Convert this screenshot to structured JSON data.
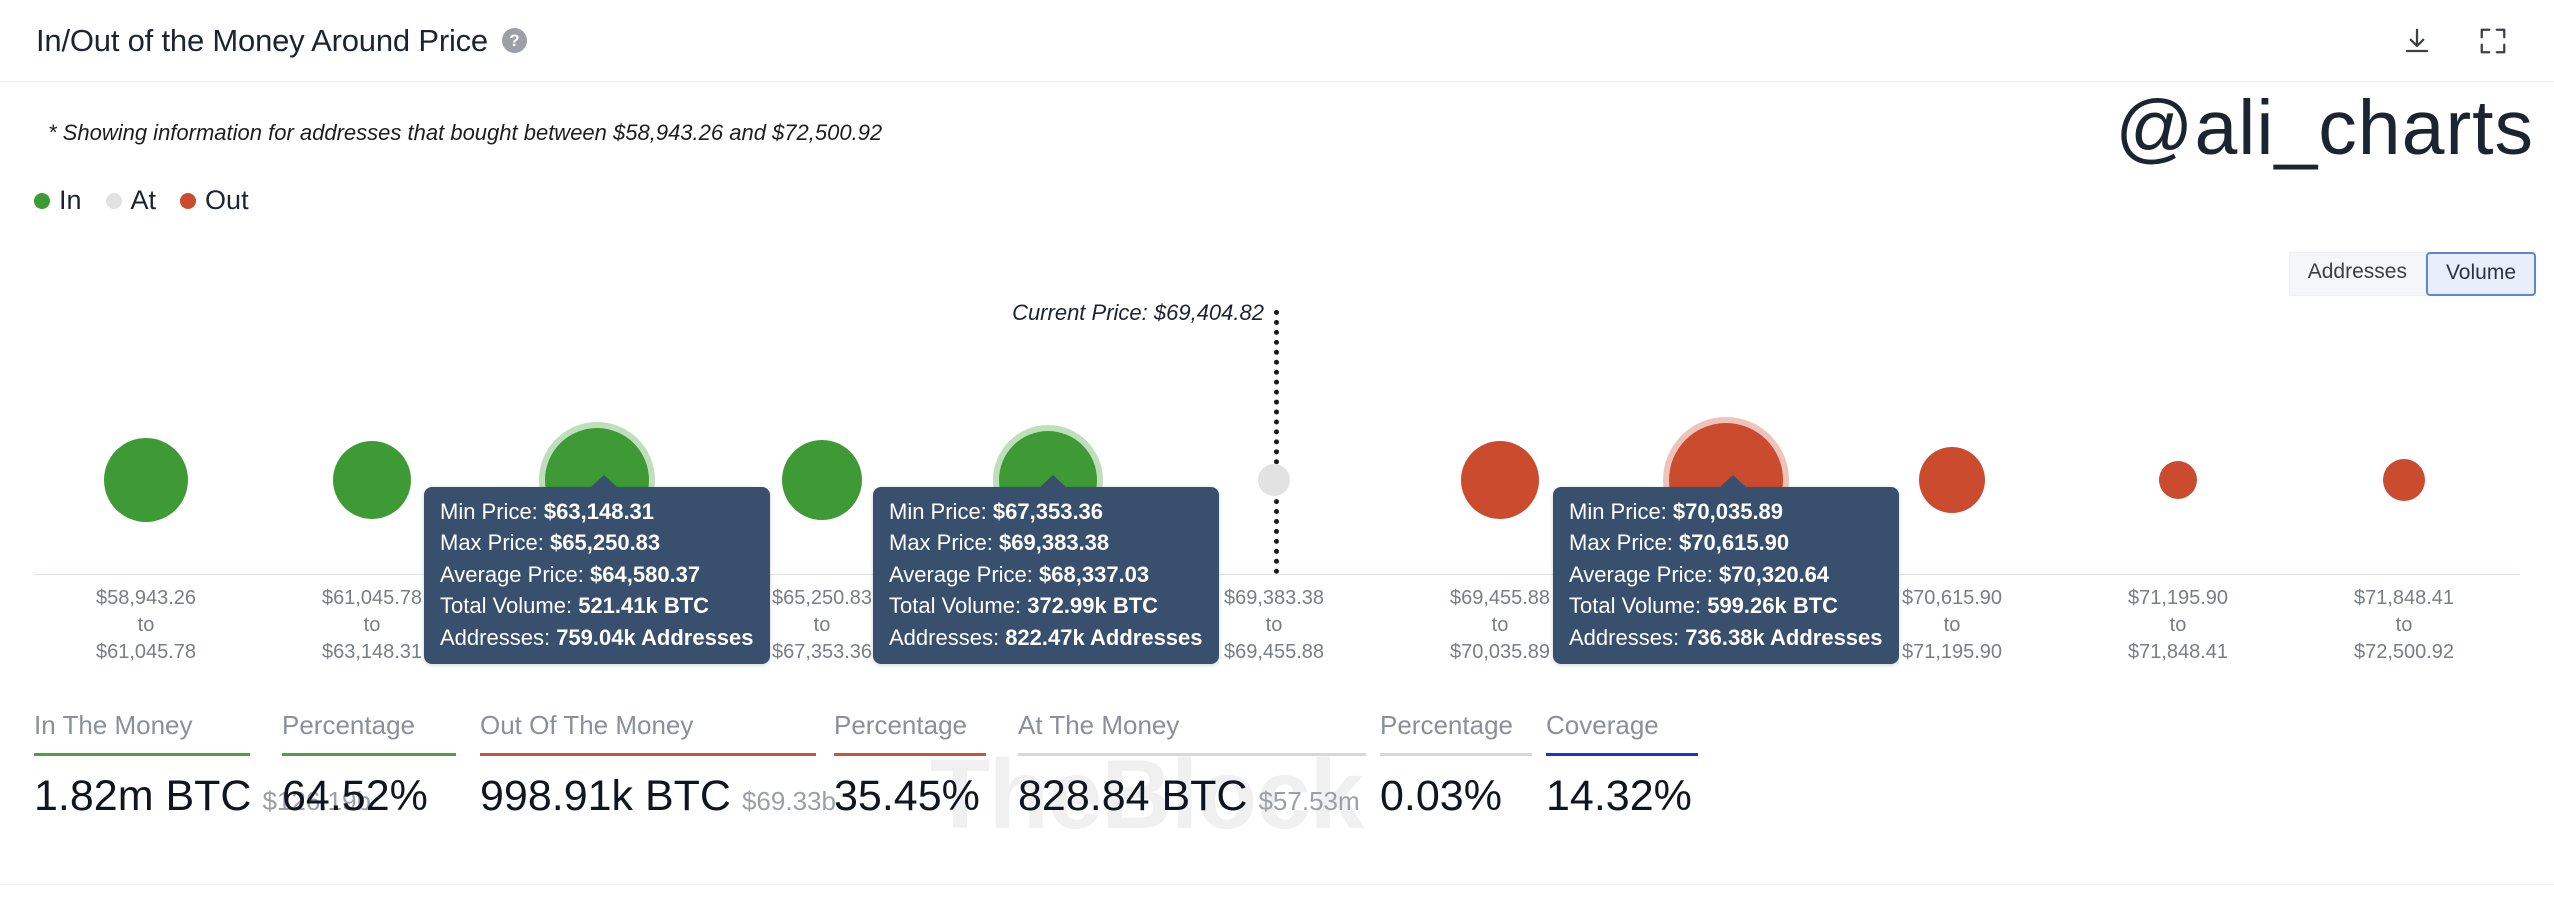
{
  "header": {
    "title": "In/Out of the Money Around Price",
    "help_icon": "question-mark-icon",
    "download_icon": "download-icon",
    "expand_icon": "expand-icon"
  },
  "subtitle": "* Showing information for addresses that bought between $58,943.26 and $72,500.92",
  "brand_watermark": "@ali_charts",
  "source_watermark": "TheBlock",
  "legend": [
    {
      "label": "In",
      "color": "#3e9a34"
    },
    {
      "label": "At",
      "color": "#e2e2e2"
    },
    {
      "label": "Out",
      "color": "#ca4b2e"
    }
  ],
  "toggle": {
    "options": [
      "Addresses",
      "Volume"
    ],
    "selected": "Volume"
  },
  "current_price": {
    "label": "Current Price: $69,404.82",
    "value": 69404.82
  },
  "tooltips": [
    {
      "min_label": "Min Price:",
      "min_value": "$63,148.31",
      "max_label": "Max Price:",
      "max_value": "$65,250.83",
      "avg_label": "Average Price:",
      "avg_value": "$64,580.37",
      "vol_label": "Total Volume:",
      "vol_value": "521.41k BTC",
      "addr_label": "Addresses:",
      "addr_value": "759.04k Addresses"
    },
    {
      "min_label": "Min Price:",
      "min_value": "$67,353.36",
      "max_label": "Max Price:",
      "max_value": "$69,383.38",
      "avg_label": "Average Price:",
      "avg_value": "$68,337.03",
      "vol_label": "Total Volume:",
      "vol_value": "372.99k BTC",
      "addr_label": "Addresses:",
      "addr_value": "822.47k Addresses"
    },
    {
      "min_label": "Min Price:",
      "min_value": "$70,035.89",
      "max_label": "Max Price:",
      "max_value": "$70,615.90",
      "avg_label": "Average Price:",
      "avg_value": "$70,320.64",
      "vol_label": "Total Volume:",
      "vol_value": "599.26k BTC",
      "addr_label": "Addresses:",
      "addr_value": "736.38k Addresses"
    }
  ],
  "stats": [
    {
      "label": "In The Money",
      "value": "1.82m BTC",
      "sub": "$126.19b",
      "rule_color": "#4f9e42"
    },
    {
      "label": "Percentage",
      "value": "64.52%",
      "sub": "",
      "rule_color": "#4f9e42"
    },
    {
      "label": "Out Of The Money",
      "value": "998.91k BTC",
      "sub": "$69.33b",
      "rule_color": "#c8543a"
    },
    {
      "label": "Percentage",
      "value": "35.45%",
      "sub": "",
      "rule_color": "#c8543a"
    },
    {
      "label": "At The Money",
      "value": "828.84 BTC",
      "sub": "$57.53m",
      "rule_color": "#d5d7da"
    },
    {
      "label": "Percentage",
      "value": "0.03%",
      "sub": "",
      "rule_color": "#d5d7da"
    },
    {
      "label": "Coverage",
      "value": "14.32%",
      "sub": "",
      "rule_color": "#2130d8"
    }
  ],
  "chart_data": {
    "type": "scatter",
    "title": "In/Out of the Money Around Price",
    "subtitle": "* Showing information for addresses that bought between $58,943.26 and $72,500.92",
    "xlabel": "",
    "ylabel": "",
    "grid": false,
    "legend_position": "top-left",
    "value_metric": "Volume",
    "unit": "BTC",
    "categories": [
      "$58,943.26\nto\n$61,045.78",
      "$61,045.78\nto\n$63,148.31",
      "$63,148.31\nto\n$65,250.83",
      "$65,250.83\nto\n$67,353.36",
      "$67,353.36\nto\n$69,383.38",
      "$69,383.38\nto\n$69,455.88",
      "$69,455.88\nto\n$70,035.89",
      "$70,035.89\nto\n$70,615.90",
      "$70,615.90\nto\n$71,195.90",
      "$71,195.90\nto\n$71,848.41",
      "$71,848.41\nto\n$72,500.92"
    ],
    "points": [
      {
        "bucket": "$58,943.26 to $61,045.78",
        "state": "In",
        "min_price": 58943.26,
        "max_price": 61045.78,
        "radius": 42
      },
      {
        "bucket": "$61,045.78 to $63,148.31",
        "state": "In",
        "min_price": 61045.78,
        "max_price": 63148.31,
        "radius": 39
      },
      {
        "bucket": "$63,148.31 to $65,250.83",
        "state": "In",
        "min_price": 63148.31,
        "max_price": 65250.83,
        "min_label": "$63,148.31",
        "max_label": "$65,250.83",
        "average_price": 64580.37,
        "total_volume": "521.41k BTC",
        "addresses": "759.04k Addresses",
        "radius": 52,
        "highlighted": true
      },
      {
        "bucket": "$65,250.83 to $67,353.36",
        "state": "In",
        "min_price": 65250.83,
        "max_price": 67353.36,
        "radius": 40
      },
      {
        "bucket": "$67,353.36 to $69,383.38",
        "state": "In",
        "min_price": 67353.36,
        "max_price": 69383.38,
        "min_label": "$67,353.36",
        "max_label": "$69,383.38",
        "average_price": 68337.03,
        "total_volume": "372.99k BTC",
        "addresses": "822.47k Addresses",
        "radius": 49,
        "highlighted": true
      },
      {
        "bucket": "$69,383.38 to $69,455.88",
        "state": "At",
        "min_price": 69383.38,
        "max_price": 69455.88,
        "radius": 16
      },
      {
        "bucket": "$69,455.88 to $70,035.89",
        "state": "Out",
        "min_price": 69455.88,
        "max_price": 70035.89,
        "radius": 39
      },
      {
        "bucket": "$70,035.89 to $70,615.90",
        "state": "Out",
        "min_price": 70035.89,
        "max_price": 70615.9,
        "min_label": "$70,035.89",
        "max_label": "$70,615.90",
        "average_price": 70320.64,
        "total_volume": "599.26k BTC",
        "addresses": "736.38k Addresses",
        "radius": 57,
        "highlighted": true
      },
      {
        "bucket": "$70,615.90 to $71,195.90",
        "state": "Out",
        "min_price": 70615.9,
        "max_price": 71195.9,
        "radius": 33
      },
      {
        "bucket": "$71,195.90 to $71,848.41",
        "state": "Out",
        "min_price": 71195.9,
        "max_price": 71848.41,
        "radius": 19
      },
      {
        "bucket": "$71,848.41 to $72,500.92",
        "state": "Out",
        "min_price": 71848.41,
        "max_price": 72500.92,
        "radius": 21
      }
    ],
    "annotations": [
      {
        "text": "Current Price: $69,404.82",
        "value": 69404.82
      }
    ],
    "summary": {
      "in_the_money_btc": "1.82m BTC",
      "in_the_money_usd": "$126.19b",
      "in_the_money_pct": "64.52%",
      "out_of_the_money_btc": "998.91k BTC",
      "out_of_the_money_usd": "$69.33b",
      "out_of_the_money_pct": "35.45%",
      "at_the_money_btc": "828.84 BTC",
      "at_the_money_usd": "$57.53m",
      "at_the_money_pct": "0.03%",
      "coverage": "14.32%"
    }
  },
  "colors": {
    "in": "#3e9a34",
    "at": "#e2e2e2",
    "out": "#ca4b2e",
    "tooltip_bg": "#38506e",
    "accent_blue": "#2130d8"
  }
}
